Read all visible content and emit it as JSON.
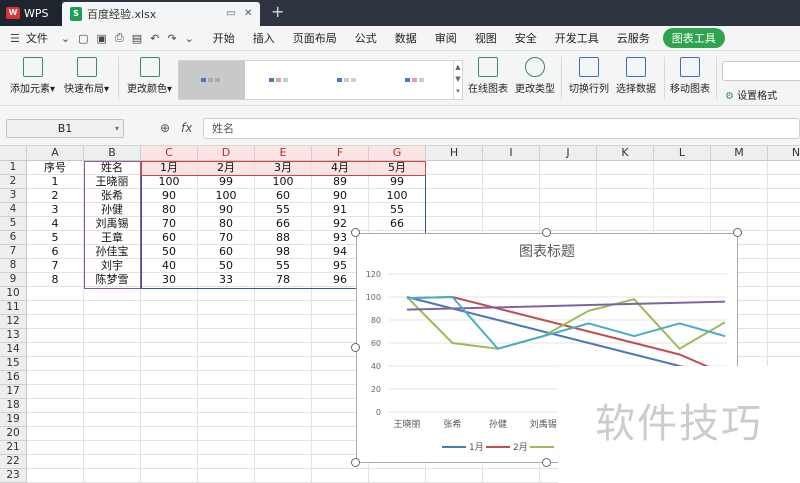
{
  "titlebar": {
    "app_name": "WPS",
    "file_name": "百度经验.xlsx"
  },
  "menubar": {
    "file_label": "文件",
    "items": [
      "开始",
      "插入",
      "页面布局",
      "公式",
      "数据",
      "审阅",
      "视图",
      "安全",
      "开发工具",
      "云服务"
    ],
    "active_tab": "图表工具"
  },
  "ribbon": {
    "add_element": "添加元素",
    "quick_layout": "快速布局",
    "change_color": "更改颜色",
    "online_chart": "在线图表",
    "change_type": "更改类型",
    "switch_rowcol": "切换行列",
    "select_data": "选择数据",
    "move_chart": "移动图表",
    "set_format": "设置格式"
  },
  "formula": {
    "cell_ref": "B1",
    "fx_label": "fx",
    "content": "姓名"
  },
  "sheet": {
    "columns": [
      "A",
      "B",
      "C",
      "D",
      "E",
      "F",
      "G",
      "H",
      "I",
      "J",
      "K",
      "L",
      "M",
      "N"
    ],
    "rows": [
      "1",
      "2",
      "3",
      "4",
      "5",
      "6",
      "7",
      "8",
      "9",
      "10",
      "11",
      "12",
      "13",
      "14",
      "15",
      "16",
      "17",
      "18",
      "19",
      "20",
      "21",
      "22",
      "23"
    ],
    "header": [
      "序号",
      "姓名",
      "1月",
      "2月",
      "3月",
      "4月",
      "5月"
    ],
    "data": [
      [
        "1",
        "王晓丽",
        "100",
        "99",
        "100",
        "89",
        "99"
      ],
      [
        "2",
        "张希",
        "90",
        "100",
        "60",
        "90",
        "100"
      ],
      [
        "3",
        "孙健",
        "80",
        "90",
        "55",
        "91",
        "55"
      ],
      [
        "4",
        "刘禹锡",
        "70",
        "80",
        "66",
        "92",
        "66"
      ],
      [
        "5",
        "王章",
        "60",
        "70",
        "88",
        "93",
        "77"
      ],
      [
        "6",
        "孙佳宝",
        "50",
        "60",
        "98",
        "94",
        "66"
      ],
      [
        "7",
        "刘宇",
        "40",
        "50",
        "55",
        "95",
        "77"
      ],
      [
        "8",
        "陈梦雪",
        "30",
        "33",
        "78",
        "96",
        "66"
      ]
    ]
  },
  "chart_data": {
    "type": "line",
    "title": "图表标题",
    "categories": [
      "王晓丽",
      "张希",
      "孙健",
      "刘禹锡"
    ],
    "x": [
      1,
      2,
      3,
      4,
      5,
      6,
      7,
      8
    ],
    "ylim": [
      0,
      120
    ],
    "yticks": [
      0,
      20,
      40,
      60,
      80,
      100,
      120
    ],
    "grid": true,
    "legend": "bottom",
    "series": [
      {
        "name": "1月",
        "color": "#4a7ab7",
        "values": [
          100,
          90,
          80,
          70,
          60,
          50,
          40,
          30
        ]
      },
      {
        "name": "2月",
        "color": "#c0504d",
        "values": [
          99,
          100,
          90,
          80,
          70,
          60,
          50,
          33
        ]
      },
      {
        "name": "3月",
        "color": "#9bbb59",
        "values": [
          100,
          60,
          55,
          66,
          88,
          98,
          55,
          78
        ]
      },
      {
        "name": "4月",
        "color": "#8064a2",
        "values": [
          89,
          90,
          91,
          92,
          93,
          94,
          95,
          96
        ]
      },
      {
        "name": "5月",
        "color": "#4bacc6",
        "values": [
          99,
          100,
          55,
          66,
          77,
          66,
          77,
          66
        ]
      }
    ],
    "legend_visible": [
      "1月",
      "2月",
      "3月"
    ]
  },
  "watermark": "软件技巧"
}
